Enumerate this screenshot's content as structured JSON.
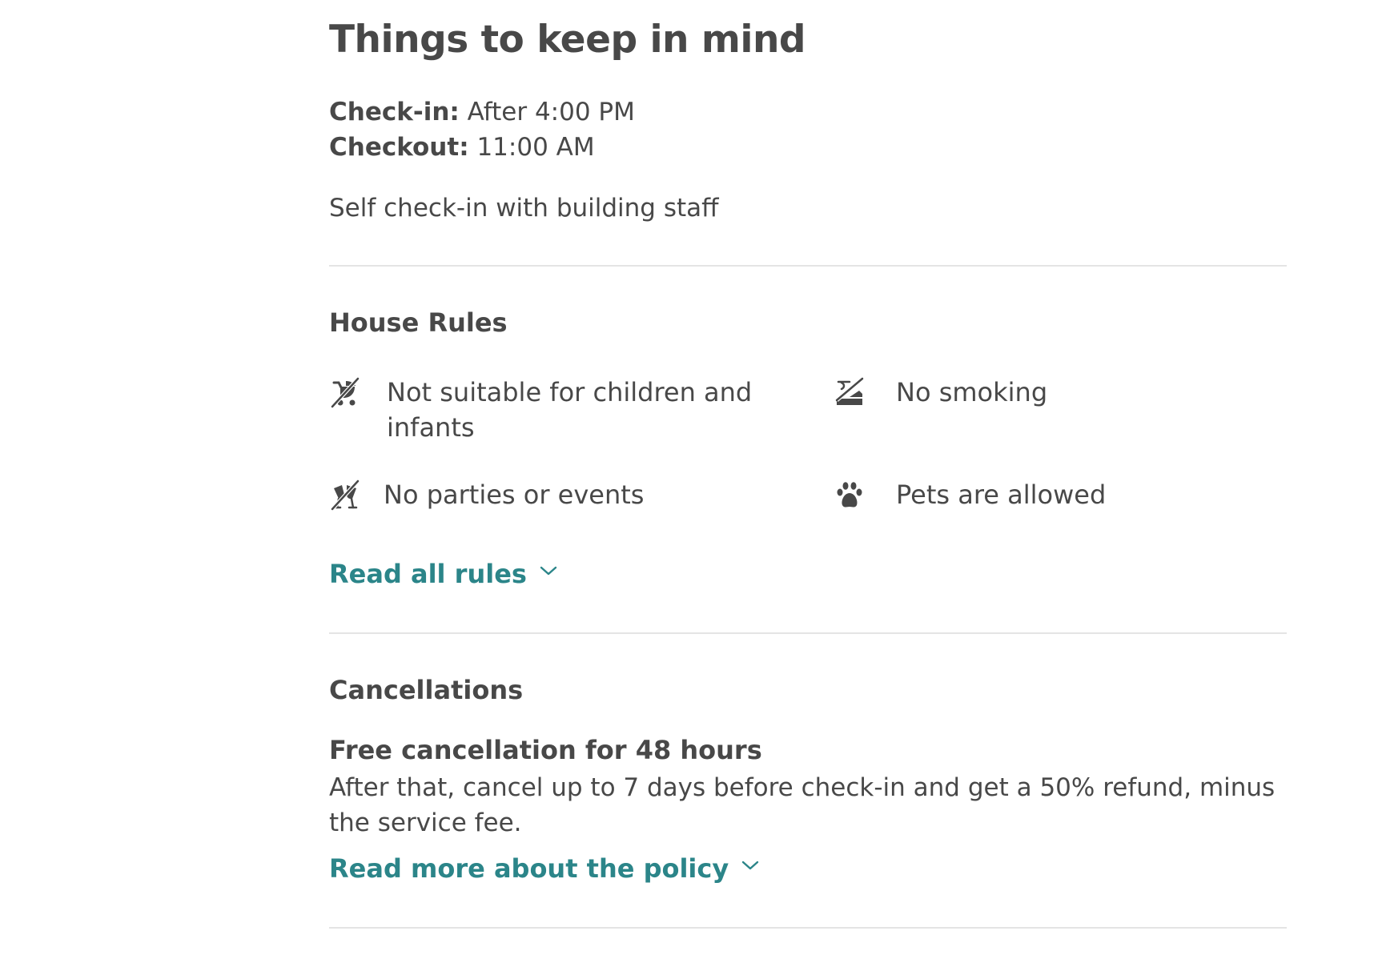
{
  "page_title": "Things to keep in mind",
  "checkin": {
    "label": "Check-in:",
    "value": "After 4:00 PM"
  },
  "checkout": {
    "label": "Checkout:",
    "value": "11:00 AM"
  },
  "self_checkin": "Self check-in with building staff",
  "house_rules": {
    "title": "House Rules",
    "items": [
      {
        "icon": "no-children-icon",
        "text": "Not suitable for children and infants"
      },
      {
        "icon": "no-smoking-icon",
        "text": "No smoking"
      },
      {
        "icon": "no-parties-icon",
        "text": "No parties or events"
      },
      {
        "icon": "paw-icon",
        "text": "Pets are allowed"
      }
    ],
    "read_all_label": "Read all rules"
  },
  "cancellations": {
    "title": "Cancellations",
    "headline": "Free cancellation for 48 hours",
    "body": "After that, cancel up to 7 days before check-in and get a 50% refund, minus the service fee.",
    "read_more_label": "Read more about the policy"
  },
  "colors": {
    "text": "#484848",
    "link": "#2b8589",
    "divider": "#e4e4e4"
  }
}
